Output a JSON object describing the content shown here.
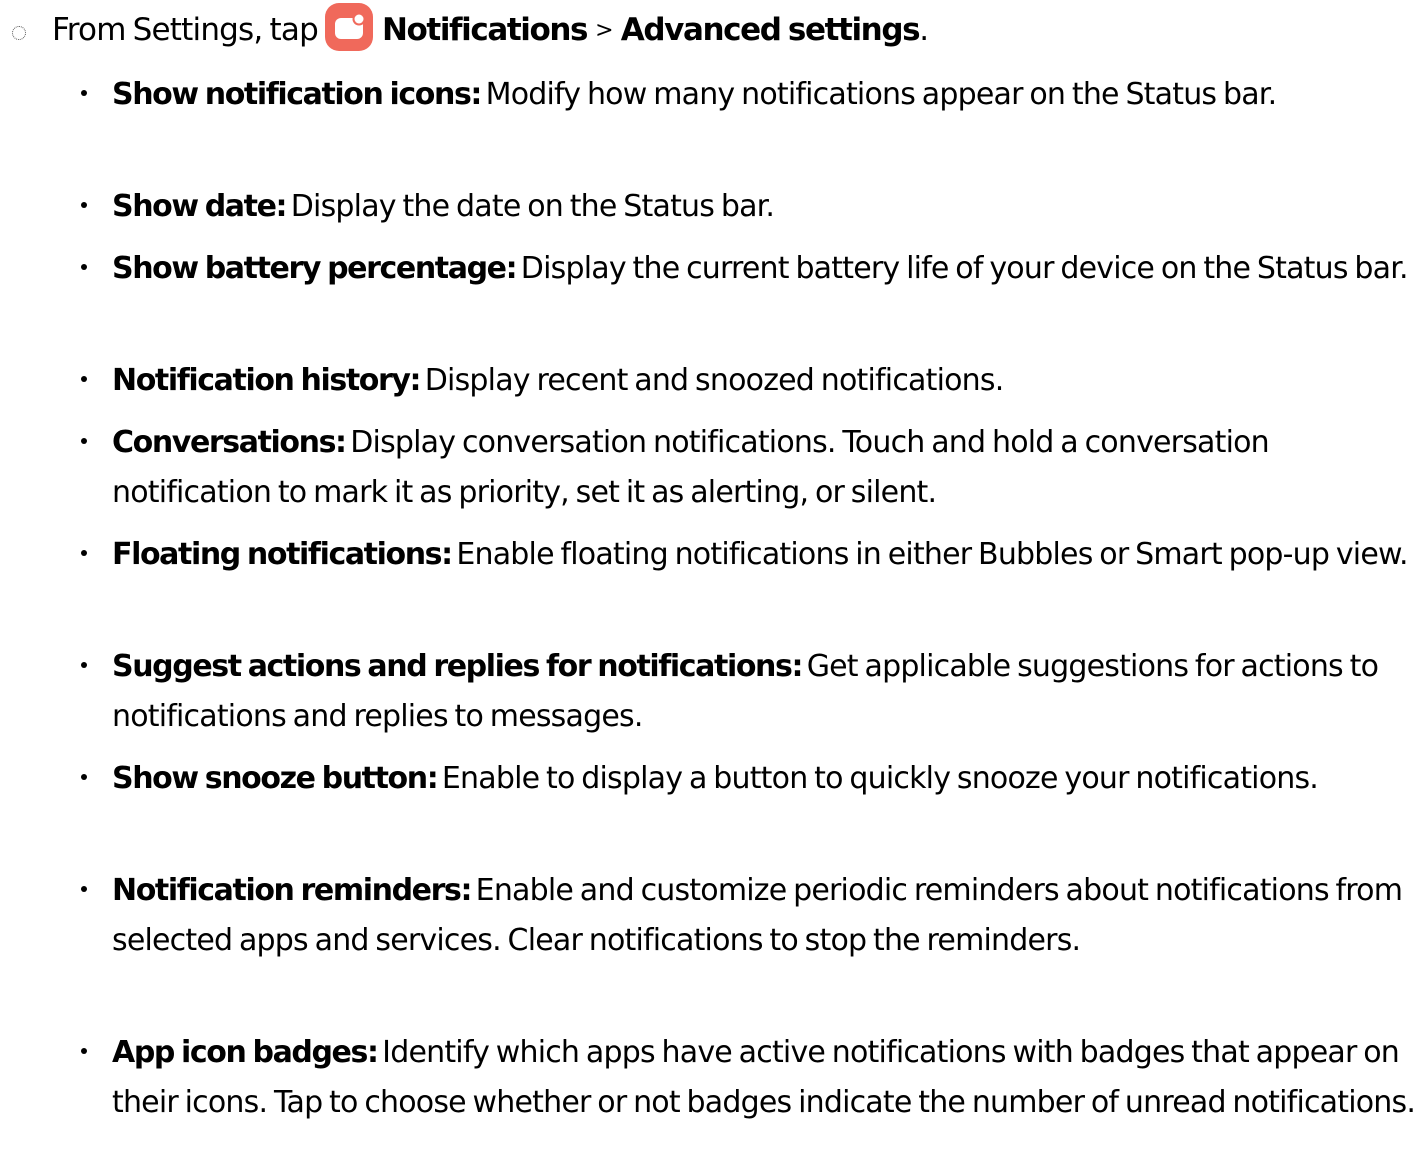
{
  "step": {
    "prefix": "From Settings, tap",
    "icon": "notifications-app-icon",
    "icon_color": "#F0695B",
    "menu_item": "Notifications",
    "separator": ">",
    "submenu_item": "Advanced settings",
    "period": "."
  },
  "options": [
    {
      "term": "Show notification icons",
      "description": "Modify how many notifications appear on the Status bar."
    },
    {
      "term": "Show date",
      "description": "Display the date on the Status bar."
    },
    {
      "term": "Show battery percentage",
      "description": "Display the current battery life of your device on the Status bar."
    },
    {
      "term": "Notification history",
      "description": "Display recent and snoozed notifications."
    },
    {
      "term": "Conversations",
      "description": "Display conversation notifications. Touch and hold a conversation notification to mark it as priority, set it as alerting, or silent."
    },
    {
      "term": "Floating notifications",
      "description": "Enable floating notifications in either Bubbles or Smart pop-up view."
    },
    {
      "term": "Suggest actions and replies for notifications",
      "description": "Get applicable suggestions for actions to notifications and replies to messages."
    },
    {
      "term": "Show snooze button",
      "description": "Enable to display a button to quickly snooze your notifications."
    },
    {
      "term": "Notification reminders",
      "description": "Enable and customize periodic reminders about notifications from selected apps and services. Clear notifications to stop the reminders."
    },
    {
      "term": "App icon badges",
      "description": "Identify which apps have active notifications with badges that appear on their icons. Tap to choose whether or not badges indicate the number of unread notifications."
    }
  ]
}
